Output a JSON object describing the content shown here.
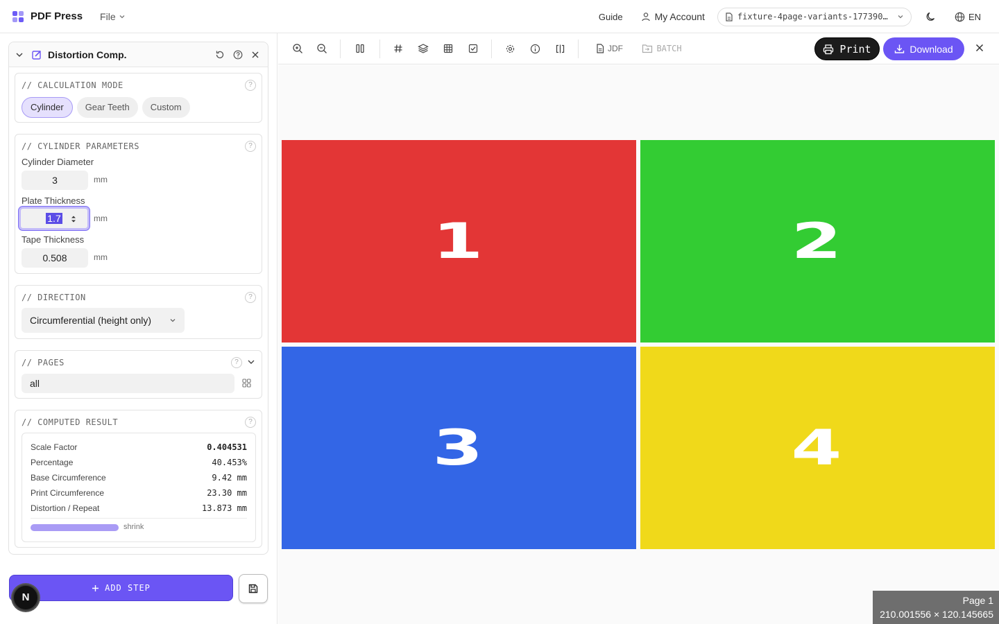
{
  "app": {
    "name": "PDF Press",
    "file_menu": "File"
  },
  "header": {
    "guide": "Guide",
    "account": "My Account",
    "file_name": "fixture-4page-variants-177390…",
    "language": "EN"
  },
  "panel": {
    "title": "Distortion Comp.",
    "calc_mode": {
      "label": "// CALCULATION MODE",
      "options": [
        "Cylinder",
        "Gear Teeth",
        "Custom"
      ],
      "selected": "Cylinder"
    },
    "cylinder": {
      "label": "// CYLINDER PARAMETERS",
      "diameter_label": "Cylinder Diameter",
      "diameter_value": "3",
      "plate_label": "Plate Thickness",
      "plate_value": "1.7",
      "tape_label": "Tape Thickness",
      "tape_value": "0.508",
      "unit": "mm"
    },
    "direction": {
      "label": "// DIRECTION",
      "value": "Circumferential (height only)"
    },
    "pages": {
      "label": "// PAGES",
      "value": "all"
    },
    "result": {
      "label": "// COMPUTED RESULT",
      "rows": [
        {
          "key": "Scale Factor",
          "value": "0.404531"
        },
        {
          "key": "Percentage",
          "value": "40.453%"
        },
        {
          "key": "Base Circumference",
          "value": "9.42 mm"
        },
        {
          "key": "Print Circumference",
          "value": "23.30 mm"
        },
        {
          "key": "Distortion / Repeat",
          "value": "13.873 mm"
        }
      ],
      "bar_fraction": 1.0,
      "bar_label": "shrink"
    },
    "help_glyph": "?"
  },
  "footer": {
    "add_step": "ADD STEP",
    "avatar_letter": "N"
  },
  "toolbar": {
    "jdf": "JDF",
    "batch": "BATCH",
    "print": "Print",
    "download": "Download"
  },
  "pages": [
    {
      "label": "1",
      "color": "#e33636"
    },
    {
      "label": "2",
      "color": "#33cc33"
    },
    {
      "label": "3",
      "color": "#3366e6"
    },
    {
      "label": "4",
      "color": "#f0d91a"
    }
  ],
  "status": {
    "page": "Page 1",
    "dims": "210.001556 × 120.145665"
  },
  "colors": {
    "accent": "#6b55f4",
    "accent_light": "#e5e0fd"
  }
}
